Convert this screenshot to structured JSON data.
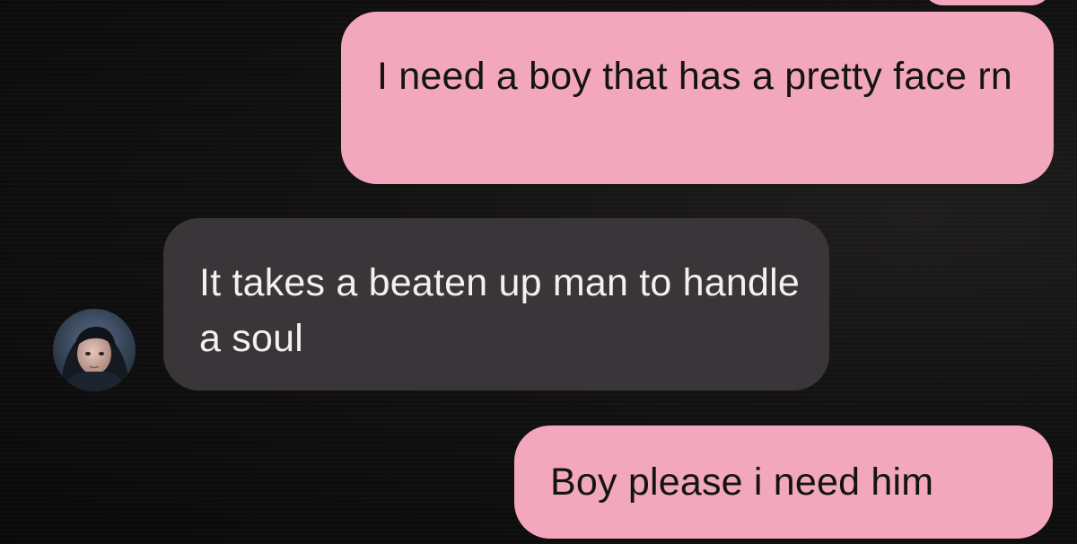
{
  "conversation": {
    "messages": [
      {
        "sender": "me",
        "text": "I need a boy that has a pretty face rn"
      },
      {
        "sender": "contact",
        "text": "It takes a beaten up man to handle a soul"
      },
      {
        "sender": "me",
        "text": "Boy please i need him"
      }
    ]
  },
  "colors": {
    "sent_bubble": "#f3a7bd",
    "received_bubble": "#3a3538",
    "background": "#0c0b0b"
  },
  "icons": {
    "avatar": "contact-avatar-photo"
  }
}
